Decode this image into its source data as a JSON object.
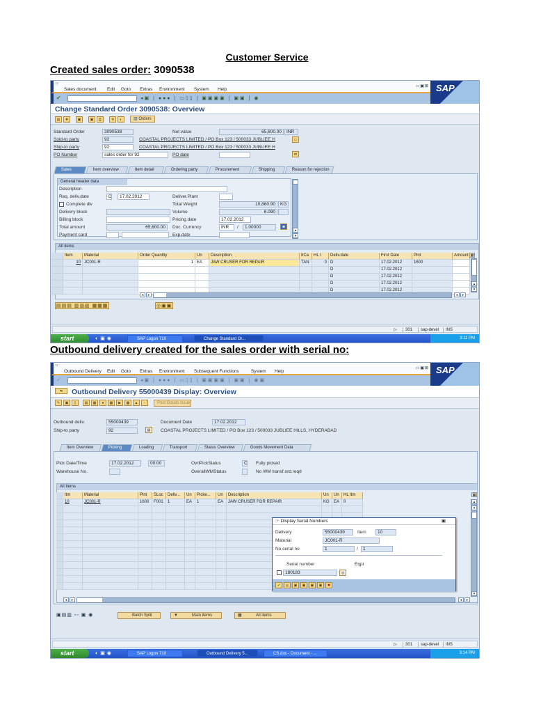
{
  "document": {
    "title": "Customer Service",
    "heading1_label": "Created sales order:",
    "heading1_value": "3090538",
    "heading2": "Outbound delivery created for the sales order with serial no:"
  },
  "colors": {
    "sap_title": "#2a4f84",
    "menu_accent": "#e8a640",
    "taskbar": "#2353c8",
    "header_cell": "#f6e4b4"
  },
  "win1": {
    "menu": [
      "Sales document",
      "Edit",
      "Goto",
      "Extras",
      "Environment",
      "System",
      "Help"
    ],
    "logo": "SAP",
    "title": "Change Standard Order 3090538: Overview",
    "orders_button": "Orders",
    "header": {
      "standard_order_label": "Standard Order",
      "standard_order": "3090538",
      "net_value_label": "Net value",
      "net_value": "65,600.00",
      "currency": "INR",
      "sold_to_label": "Sold-to party",
      "sold_to": "92",
      "sold_to_name": "COASTAL PROJECTS LIMITED / PO Box 123 / 500033 JUBLIEE H",
      "ship_to_label": "Ship-to party",
      "ship_to": "92",
      "ship_to_name": "COASTAL PROJECTS LIMITED / PO Box 123 / 500033 JUBLIEE H",
      "po_number_label": "PO Number",
      "po_number": "sales order for 92",
      "po_date_label": "PO date",
      "po_date": ""
    },
    "tabs": [
      "Sales",
      "Item overview",
      "Item detail",
      "Ordering party",
      "Procurement",
      "Shipping",
      "Reason for rejection"
    ],
    "active_tab": 0,
    "general": {
      "title": "General header data",
      "description_label": "Description",
      "req_deliv_label": "Req. deliv.date",
      "req_deliv_type": "D",
      "req_deliv_date": "17.02.2012",
      "complete_dlv_label": "Complete dlv",
      "delivery_block_label": "Delivery block",
      "billing_block_label": "Billing block",
      "total_amount_label": "Total amount",
      "total_amount": "65,600.00",
      "payment_card_label": "Payment card",
      "deliver_plant_label": "Deliver.Plant",
      "total_weight_label": "Total Weight",
      "total_weight": "10,860.90",
      "weight_unit": "KG",
      "volume_label": "Volume",
      "volume": "6.090",
      "pricing_date_label": "Pricing date",
      "pricing_date": "17.02.2012",
      "doc_currency_label": "Doc. Currency",
      "doc_currency": "INR",
      "exchange_rate": "1.00000",
      "exp_date_label": "Exp.date"
    },
    "items": {
      "title": "All items",
      "columns": [
        "Item",
        "Material",
        "Order Quantity",
        "Un",
        "Description",
        "ItCa",
        "HL I",
        "Deliv.date",
        "First Date",
        "Plnt",
        "Amount"
      ],
      "rows": [
        [
          "10",
          "JC001-R",
          "1",
          "EA",
          "JAW CRUSER FOR REPAIR",
          "TAN",
          "0",
          "D",
          "17.02.2012",
          "1600",
          ""
        ],
        [
          "",
          "",
          "",
          "",
          "",
          "",
          "",
          "D",
          "17.02.2012",
          "",
          ""
        ],
        [
          "",
          "",
          "",
          "",
          "",
          "",
          "",
          "D",
          "17.02.2012",
          "",
          ""
        ],
        [
          "",
          "",
          "",
          "",
          "",
          "",
          "",
          "D",
          "17.02.2012",
          "",
          ""
        ],
        [
          "",
          "",
          "",
          "",
          "",
          "",
          "",
          "D",
          "17.02.2012",
          "",
          ""
        ]
      ]
    },
    "status": {
      "client": "301",
      "server": "sap-devel",
      "mode": "INS"
    },
    "taskbar": {
      "start": "start",
      "tasks": [
        "SAP Logon 710",
        "Change Standard Or..."
      ],
      "time": "3:11 PM"
    }
  },
  "win2": {
    "menu": [
      "Outbound Delivery",
      "Edit",
      "Goto",
      "Extras",
      "Environment",
      "Subsequent Functions",
      "System",
      "Help"
    ],
    "logo": "SAP",
    "title": "Outbound Delivery 55000439 Display: Overview",
    "post_goods_issue": "Post Goods Issue",
    "header": {
      "outbound_deliv_label": "Outbound deliv.",
      "outbound_deliv": "55000439",
      "document_date_label": "Document Date",
      "document_date": "17.02.2012",
      "ship_to_label": "Ship-to party",
      "ship_to": "92",
      "ship_to_name": "COASTAL PROJECTS LIMITED / PO Box 123 / 500033 JUBLIEE HILLS, HYDERABAD"
    },
    "tabs": [
      "Item Overview",
      "Picking",
      "Loading",
      "Transport",
      "Status Overview",
      "Goods Movement Data"
    ],
    "active_tab": 1,
    "picking": {
      "pick_date_label": "Pick Date/Time",
      "pick_date": "17.02.2012",
      "pick_time": "00:00",
      "warehouse_label": "Warehouse No.",
      "ovrl_pick_label": "OvrlPickStatus",
      "ovrl_pick": "C",
      "ovrl_pick_text": "Fully picked",
      "overall_wm_label": "OverallWMStatus",
      "overall_wm_text": "No WM transf.ord.reqd"
    },
    "items": {
      "title": "All Items",
      "columns": [
        "Itm",
        "Material",
        "Plnt",
        "SLoc",
        "Deliv...",
        "Un",
        "Picke...",
        "Un",
        "Description",
        "Un",
        "Un",
        "HL Itm"
      ],
      "rows": [
        [
          "10",
          "JC001-R",
          "1600",
          "F001",
          "1",
          "EA",
          "1",
          "EA",
          "JAW CRUSER FOR REPAIR",
          "KG",
          "EA",
          "0"
        ],
        [
          "",
          "",
          "",
          "",
          "",
          "",
          "",
          "",
          "",
          "",
          "",
          ""
        ],
        [
          "",
          "",
          "",
          "",
          "",
          "",
          "",
          "",
          "",
          "",
          "",
          ""
        ],
        [
          "",
          "",
          "",
          "",
          "",
          "",
          "",
          "",
          "",
          "",
          "",
          ""
        ],
        [
          "",
          "",
          "",
          "",
          "",
          "",
          "",
          "",
          "",
          "",
          "",
          ""
        ],
        [
          "",
          "",
          "",
          "",
          "",
          "",
          "",
          "",
          "",
          "",
          "",
          ""
        ],
        [
          "",
          "",
          "",
          "",
          "",
          "",
          "",
          "",
          "",
          "",
          "",
          ""
        ],
        [
          "",
          "",
          "",
          "",
          "",
          "",
          "",
          "",
          "",
          "",
          "",
          ""
        ],
        [
          "",
          "",
          "",
          "",
          "",
          "",
          "",
          "",
          "",
          "",
          "",
          ""
        ],
        [
          "",
          "",
          "",
          "",
          "",
          "",
          "",
          "",
          "",
          "",
          "",
          ""
        ],
        [
          "",
          "",
          "",
          "",
          "",
          "",
          "",
          "",
          "",
          "",
          "",
          ""
        ],
        [
          "",
          "",
          "",
          "",
          "",
          "",
          "",
          "",
          "",
          "",
          "",
          ""
        ],
        [
          "",
          "",
          "",
          "",
          "",
          "",
          "",
          "",
          "",
          "",
          "",
          ""
        ]
      ]
    },
    "buttons": {
      "batch_split": "Batch Split",
      "main_items": "Main items",
      "all_items": "All items"
    },
    "serial_dialog": {
      "title": "Display Serial Numbers",
      "delivery_label": "Delivery",
      "delivery": "55000439",
      "item_label": "Item",
      "item": "10",
      "material_label": "Material",
      "material": "JC001-R",
      "no_serial_label": "No.serial no",
      "no_serial": "1",
      "no_serial_total": "1",
      "serial_number_label": "Serial number",
      "equipment_label": "Eqpt",
      "serial_number": "180183"
    },
    "status": {
      "client": "301",
      "server": "sap-devel",
      "mode": "INS"
    },
    "taskbar": {
      "start": "start",
      "tasks": [
        "SAP Logon 710",
        "Outbound Delivery 5...",
        "CS.doc - Document - ..."
      ],
      "time": "3:14 PM"
    }
  }
}
